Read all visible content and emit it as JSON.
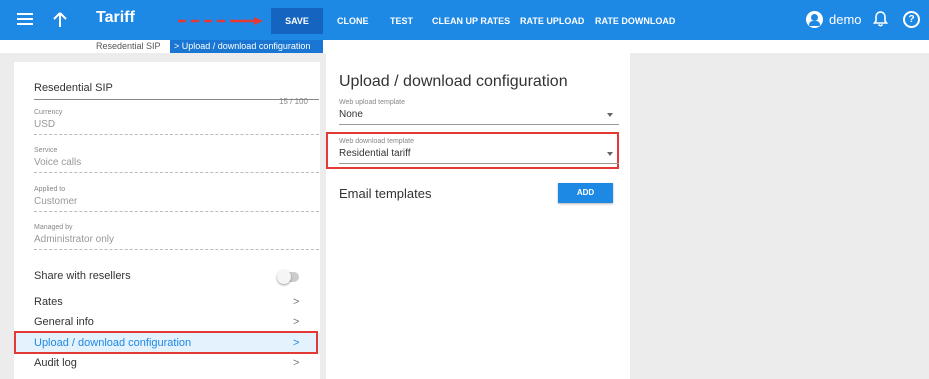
{
  "header": {
    "title": "Tariff",
    "save_label": "SAVE",
    "actions": [
      "CLONE",
      "TEST",
      "CLEAN UP RATES",
      "RATE UPLOAD",
      "RATE DOWNLOAD"
    ],
    "user": "demo"
  },
  "breadcrumb": {
    "parent": "Resedential SIP",
    "current": "Upload / download configuration"
  },
  "form": {
    "name_value": "Resedential SIP",
    "name_counter": "15 / 100",
    "currency": {
      "label": "Currency",
      "value": "USD"
    },
    "service": {
      "label": "Service",
      "value": "Voice calls"
    },
    "applied_to": {
      "label": "Applied to",
      "value": "Customer"
    },
    "managed_by": {
      "label": "Managed by",
      "value": "Administrator only"
    },
    "share_label": "Share with resellers",
    "share_enabled": false
  },
  "nav": [
    {
      "label": "Rates"
    },
    {
      "label": "General info"
    },
    {
      "label": "Upload / download configuration",
      "active": true
    },
    {
      "label": "Audit log"
    }
  ],
  "main": {
    "title": "Upload / download configuration",
    "upload_template": {
      "label": "Web upload template",
      "value": "None"
    },
    "download_template": {
      "label": "Web download template",
      "value": "Residential tariff"
    },
    "email_label": "Email templates",
    "add_label": "ADD"
  },
  "colors": {
    "primary": "#1e88e5",
    "primary_dark": "#1565c0",
    "highlight": "#e53935",
    "arrow": "#e53935"
  },
  "icons": [
    "menu-icon",
    "back-arrow-icon",
    "user-icon",
    "bell-icon",
    "help-icon",
    "chevron-right-icon",
    "dropdown-caret-icon"
  ]
}
